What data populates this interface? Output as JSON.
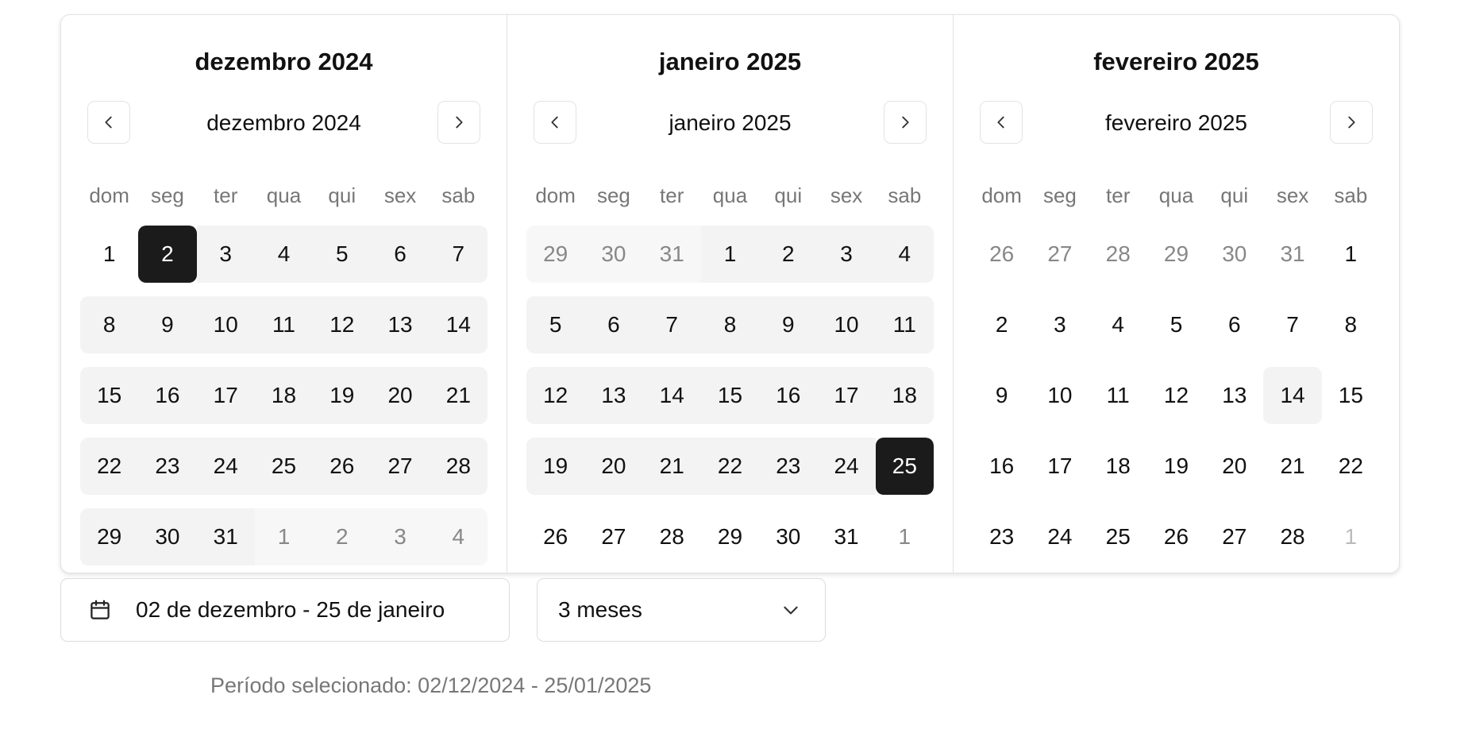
{
  "calendars": [
    {
      "title": "dezembro 2024",
      "nav_label": "dezembro 2024",
      "weeks": [
        [
          {
            "d": "1"
          },
          {
            "d": "2",
            "s": "selected"
          },
          {
            "d": "3",
            "s": "inrange"
          },
          {
            "d": "4",
            "s": "inrange"
          },
          {
            "d": "5",
            "s": "inrange"
          },
          {
            "d": "6",
            "s": "inrange"
          },
          {
            "d": "7",
            "s": "inrange"
          }
        ],
        [
          {
            "d": "8",
            "s": "inrange"
          },
          {
            "d": "9",
            "s": "inrange"
          },
          {
            "d": "10",
            "s": "inrange"
          },
          {
            "d": "11",
            "s": "inrange"
          },
          {
            "d": "12",
            "s": "inrange"
          },
          {
            "d": "13",
            "s": "inrange"
          },
          {
            "d": "14",
            "s": "inrange"
          }
        ],
        [
          {
            "d": "15",
            "s": "inrange"
          },
          {
            "d": "16",
            "s": "inrange"
          },
          {
            "d": "17",
            "s": "inrange"
          },
          {
            "d": "18",
            "s": "inrange"
          },
          {
            "d": "19",
            "s": "inrange"
          },
          {
            "d": "20",
            "s": "inrange"
          },
          {
            "d": "21",
            "s": "inrange"
          }
        ],
        [
          {
            "d": "22",
            "s": "inrange"
          },
          {
            "d": "23",
            "s": "inrange"
          },
          {
            "d": "24",
            "s": "inrange"
          },
          {
            "d": "25",
            "s": "inrange"
          },
          {
            "d": "26",
            "s": "inrange"
          },
          {
            "d": "27",
            "s": "inrange"
          },
          {
            "d": "28",
            "s": "inrange"
          }
        ],
        [
          {
            "d": "29",
            "s": "inrange"
          },
          {
            "d": "30",
            "s": "inrange"
          },
          {
            "d": "31",
            "s": "inrange"
          },
          {
            "d": "1",
            "s": "outside-range"
          },
          {
            "d": "2",
            "s": "outside-range"
          },
          {
            "d": "3",
            "s": "outside-range"
          },
          {
            "d": "4",
            "s": "outside-range"
          }
        ]
      ]
    },
    {
      "title": "janeiro 2025",
      "nav_label": "janeiro 2025",
      "weeks": [
        [
          {
            "d": "29",
            "s": "outside-range"
          },
          {
            "d": "30",
            "s": "outside-range"
          },
          {
            "d": "31",
            "s": "outside-range"
          },
          {
            "d": "1",
            "s": "inrange"
          },
          {
            "d": "2",
            "s": "inrange"
          },
          {
            "d": "3",
            "s": "inrange"
          },
          {
            "d": "4",
            "s": "inrange"
          }
        ],
        [
          {
            "d": "5",
            "s": "inrange"
          },
          {
            "d": "6",
            "s": "inrange"
          },
          {
            "d": "7",
            "s": "inrange"
          },
          {
            "d": "8",
            "s": "inrange"
          },
          {
            "d": "9",
            "s": "inrange"
          },
          {
            "d": "10",
            "s": "inrange"
          },
          {
            "d": "11",
            "s": "inrange"
          }
        ],
        [
          {
            "d": "12",
            "s": "inrange"
          },
          {
            "d": "13",
            "s": "inrange"
          },
          {
            "d": "14",
            "s": "inrange"
          },
          {
            "d": "15",
            "s": "inrange"
          },
          {
            "d": "16",
            "s": "inrange"
          },
          {
            "d": "17",
            "s": "inrange"
          },
          {
            "d": "18",
            "s": "inrange"
          }
        ],
        [
          {
            "d": "19",
            "s": "inrange"
          },
          {
            "d": "20",
            "s": "inrange"
          },
          {
            "d": "21",
            "s": "inrange"
          },
          {
            "d": "22",
            "s": "inrange"
          },
          {
            "d": "23",
            "s": "inrange"
          },
          {
            "d": "24",
            "s": "inrange"
          },
          {
            "d": "25",
            "s": "selected"
          }
        ],
        [
          {
            "d": "26"
          },
          {
            "d": "27"
          },
          {
            "d": "28"
          },
          {
            "d": "29"
          },
          {
            "d": "30"
          },
          {
            "d": "31"
          },
          {
            "d": "1",
            "s": "outside"
          }
        ]
      ]
    },
    {
      "title": "fevereiro 2025",
      "nav_label": "fevereiro 2025",
      "weeks": [
        [
          {
            "d": "26",
            "s": "outside"
          },
          {
            "d": "27",
            "s": "outside"
          },
          {
            "d": "28",
            "s": "outside"
          },
          {
            "d": "29",
            "s": "outside"
          },
          {
            "d": "30",
            "s": "outside"
          },
          {
            "d": "31",
            "s": "outside"
          },
          {
            "d": "1"
          }
        ],
        [
          {
            "d": "2"
          },
          {
            "d": "3"
          },
          {
            "d": "4"
          },
          {
            "d": "5"
          },
          {
            "d": "6"
          },
          {
            "d": "7"
          },
          {
            "d": "8"
          }
        ],
        [
          {
            "d": "9"
          },
          {
            "d": "10"
          },
          {
            "d": "11"
          },
          {
            "d": "12"
          },
          {
            "d": "13"
          },
          {
            "d": "14",
            "s": "today"
          },
          {
            "d": "15"
          }
        ],
        [
          {
            "d": "16"
          },
          {
            "d": "17"
          },
          {
            "d": "18"
          },
          {
            "d": "19"
          },
          {
            "d": "20"
          },
          {
            "d": "21"
          },
          {
            "d": "22"
          }
        ],
        [
          {
            "d": "23"
          },
          {
            "d": "24"
          },
          {
            "d": "25"
          },
          {
            "d": "26"
          },
          {
            "d": "27"
          },
          {
            "d": "28"
          },
          {
            "d": "1",
            "s": "outside-light"
          }
        ]
      ]
    }
  ],
  "weekdays": [
    "dom",
    "seg",
    "ter",
    "qua",
    "qui",
    "sex",
    "sab"
  ],
  "date_input": {
    "value": "02 de dezembro - 25 de janeiro",
    "icon": "calendar-icon"
  },
  "months_select": {
    "value": "3 meses",
    "icon": "chevron-down-icon"
  },
  "summary": "Período selecionado: 02/12/2024 - 25/01/2025",
  "colors": {
    "selected_bg": "#1b1b1b",
    "range_bg": "#f3f3f3",
    "muted_text": "#888888"
  }
}
